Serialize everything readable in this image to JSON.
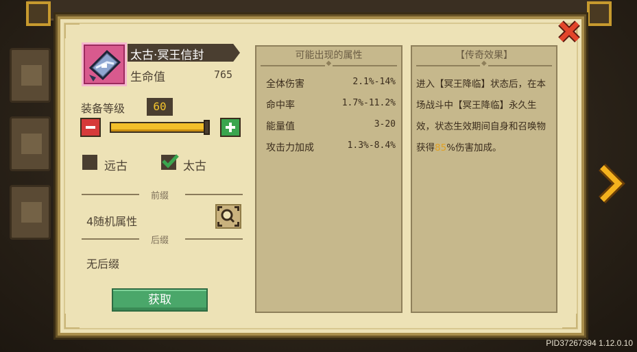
{
  "item": {
    "name": "太古·冥王信封",
    "stat_label": "生命值",
    "stat_value": "765"
  },
  "level": {
    "label": "装备等级",
    "value": "60",
    "progress": 1.0
  },
  "filters": [
    {
      "label": "远古",
      "checked": false
    },
    {
      "label": "太古",
      "checked": true
    }
  ],
  "affixes": {
    "prefix_header": "前缀",
    "prefix_value": "4随机属性",
    "suffix_header": "后缀",
    "suffix_value": "无后缀"
  },
  "acquire_label": "获取",
  "attributes_panel": {
    "title": "可能出现的属性",
    "rows": [
      {
        "name": "全体伤害",
        "range": "2.1%-14%"
      },
      {
        "name": "命中率",
        "range": "1.7%-11.2%"
      },
      {
        "name": "能量值",
        "range": "3-20"
      },
      {
        "name": "攻击力加成",
        "range": "1.3%-8.4%"
      }
    ]
  },
  "legend_panel": {
    "title": "【传奇效果】",
    "text_before": "进入【冥王降临】状态后，在本场战斗中【冥王降临】永久生效，状态生效期间自身和召唤物获得",
    "highlight": "85",
    "text_after": "%伤害加成。"
  },
  "colors": {
    "highlight": "#e0a022",
    "minus": "#d63a3a",
    "plus": "#3aa54e",
    "acquire": "#4aa76a",
    "slider": "#f2bf2a"
  },
  "footer": "PID37267394 1.12.0.10"
}
